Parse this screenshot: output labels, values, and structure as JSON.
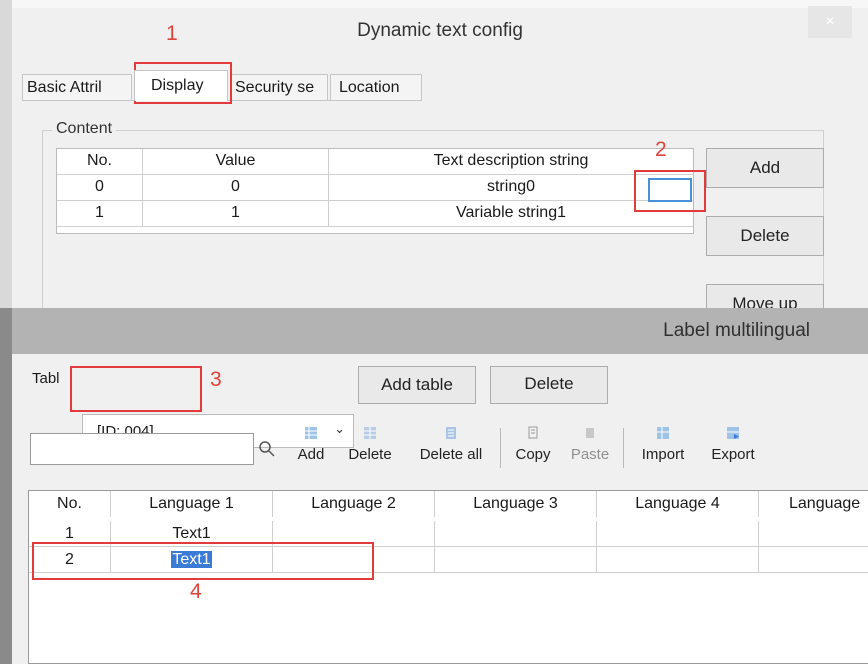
{
  "dynamic_text_config": {
    "title": "Dynamic text config",
    "close_glyph": "×",
    "tabs": [
      "Basic Attril",
      "Display",
      "Security se",
      "Location"
    ],
    "active_tab": "Display",
    "content_group_label": "Content",
    "table": {
      "columns": [
        "No.",
        "Value",
        "Text description string"
      ],
      "rows": [
        {
          "no": "0",
          "value": "0",
          "text": "string0"
        },
        {
          "no": "1",
          "value": "1",
          "text": "Variable string1"
        }
      ]
    },
    "buttons": {
      "add": "Add",
      "delete": "Delete",
      "move_up": "Move up"
    }
  },
  "label_multilingual": {
    "title": "Label multilingual",
    "table_label": "Tabl",
    "table_select_value": "[ID: 004]",
    "chevron_glyph": "⌄",
    "buttons": {
      "add_table": "Add table",
      "delete": "Delete"
    },
    "search_placeholder": "",
    "toolbar": [
      {
        "label": "Add",
        "icon": "add-row-icon",
        "enabled": true
      },
      {
        "label": "Delete",
        "icon": "delete-row-icon",
        "enabled": true
      },
      {
        "label": "Delete all",
        "icon": "delete-all-icon",
        "enabled": true
      },
      {
        "label": "Copy",
        "icon": "copy-icon",
        "enabled": true
      },
      {
        "label": "Paste",
        "icon": "paste-icon",
        "enabled": false
      },
      {
        "label": "Import",
        "icon": "import-icon",
        "enabled": true
      },
      {
        "label": "Export",
        "icon": "export-icon",
        "enabled": true
      }
    ],
    "grid": {
      "columns": [
        "No.",
        "Language 1",
        "Language 2",
        "Language 3",
        "Language 4",
        "Language"
      ],
      "rows": [
        {
          "no": "1",
          "lang1": "Text1"
        },
        {
          "no": "2",
          "lang1": "Text1"
        }
      ]
    }
  },
  "annotations": {
    "step1": "1",
    "step2": "2",
    "step3": "3",
    "step4": "4",
    "color": "#e33b3b"
  },
  "colors": {
    "selection": "#3a7bd5",
    "edit_focus": "#4a90d9",
    "titlebar": "#b3b3b3"
  }
}
